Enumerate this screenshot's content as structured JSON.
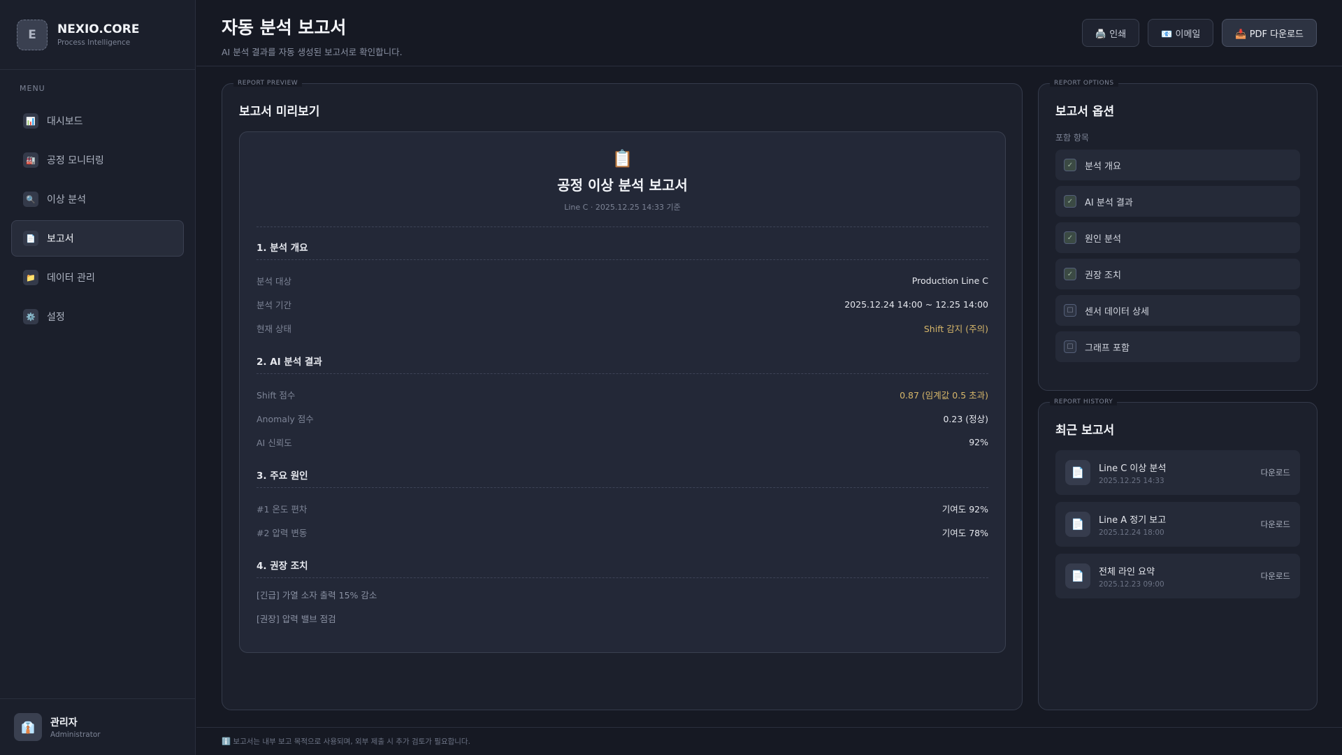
{
  "brand": {
    "logo_letter": "E",
    "name": "NEXIO.CORE",
    "subtitle": "Process Intelligence"
  },
  "sidebar": {
    "menu_label": "MENU",
    "items": [
      {
        "icon": "📊",
        "label": "대시보드"
      },
      {
        "icon": "🏭",
        "label": "공정 모니터링"
      },
      {
        "icon": "🔍",
        "label": "이상 분석"
      },
      {
        "icon": "📄",
        "label": "보고서",
        "active": true
      },
      {
        "icon": "📁",
        "label": "데이터 관리"
      },
      {
        "icon": "⚙️",
        "label": "설정"
      }
    ],
    "user": {
      "avatar": "👔",
      "name": "관리자",
      "role": "Administrator"
    }
  },
  "header": {
    "title": "자동 분석 보고서",
    "subtitle": "AI 분석 결과를 자동 생성된 보고서로 확인합니다.",
    "actions": {
      "print": "🖨️ 인쇄",
      "email": "📧 이메일",
      "pdf": "📥 PDF 다운로드"
    }
  },
  "preview": {
    "tag": "REPORT PREVIEW",
    "title": "보고서 미리보기",
    "report": {
      "icon": "📋",
      "title": "공정 이상 분석 보고서",
      "meta": "Line C · 2025.12.25 14:33 기준",
      "s1": {
        "title": "1. 분석 개요",
        "rows": [
          {
            "k": "분석 대상",
            "v": "Production Line C"
          },
          {
            "k": "분석 기간",
            "v": "2025.12.24 14:00 ~ 12.25 14:00"
          },
          {
            "k": "현재 상태",
            "v": "Shift 감지 (주의)"
          }
        ]
      },
      "s2": {
        "title": "2. AI 분석 결과",
        "rows": [
          {
            "k": "Shift 점수",
            "v": "0.87 (임계값 0.5 초과)"
          },
          {
            "k": "Anomaly 점수",
            "v": "0.23 (정상)"
          },
          {
            "k": "AI 신뢰도",
            "v": "92%"
          }
        ]
      },
      "s3": {
        "title": "3. 주요 원인",
        "rows": [
          {
            "k": "#1 온도 편차",
            "v": "기여도 92%"
          },
          {
            "k": "#2 압력 변동",
            "v": "기여도 78%"
          }
        ]
      },
      "s4": {
        "title": "4. 권장 조치",
        "lines": [
          "[긴급] 가열 소자 출력 15% 감소",
          "[권장] 압력 밸브 점검"
        ]
      }
    }
  },
  "options": {
    "tag": "REPORT OPTIONS",
    "title": "보고서 옵션",
    "label": "포함 항목",
    "items": [
      {
        "label": "분석 개요",
        "checked": true,
        "mark": "✓"
      },
      {
        "label": "AI 분석 결과",
        "checked": true,
        "mark": "✓"
      },
      {
        "label": "원인 분석",
        "checked": true,
        "mark": "✓"
      },
      {
        "label": "권장 조치",
        "checked": true,
        "mark": "✓"
      },
      {
        "label": "센서 데이터 상세",
        "checked": false,
        "mark": "☐"
      },
      {
        "label": "그래프 포함",
        "checked": false,
        "mark": "☐"
      }
    ]
  },
  "history": {
    "tag": "REPORT HISTORY",
    "title": "최근 보고서",
    "items": [
      {
        "icon": "📄",
        "name": "Line C 이상 분석",
        "date": "2025.12.25 14:33",
        "action": "다운로드"
      },
      {
        "icon": "📄",
        "name": "Line A 정기 보고",
        "date": "2025.12.24 18:00",
        "action": "다운로드"
      },
      {
        "icon": "📄",
        "name": "전체 라인 요약",
        "date": "2025.12.23 09:00",
        "action": "다운로드"
      }
    ]
  },
  "footer": {
    "note": "ℹ️ 보고서는 내부 보고 목적으로 사용되며, 외부 제출 시 추가 검토가 필요합니다."
  },
  "colors": {
    "accent_warn": "#d7b76a",
    "background": "#161923",
    "panel": "#1c202c"
  }
}
